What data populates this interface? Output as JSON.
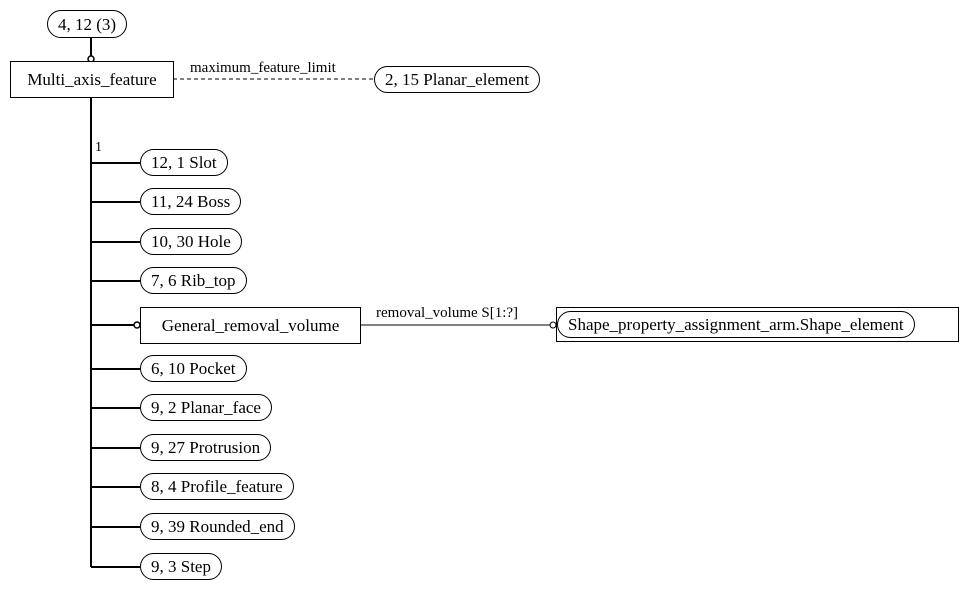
{
  "diagram": {
    "parent_ref": "4, 12 (3)",
    "main_entity": "Multi_axis_feature",
    "dashed_relation": {
      "label": "maximum_feature_limit",
      "target": "2, 15 Planar_element"
    },
    "cardinality": "1",
    "subtypes": [
      {
        "label": "12, 1 Slot"
      },
      {
        "label": "11, 24 Boss"
      },
      {
        "label": "10, 30 Hole"
      },
      {
        "label": "7, 6 Rib_top"
      },
      {
        "label": "General_removal_volume",
        "kind": "entity"
      },
      {
        "label": "6, 10 Pocket"
      },
      {
        "label": "9, 2 Planar_face"
      },
      {
        "label": "9, 27 Protrusion"
      },
      {
        "label": "8, 4 Profile_feature"
      },
      {
        "label": "9, 39 Rounded_end"
      },
      {
        "label": "9, 3 Step"
      }
    ],
    "removal_relation": {
      "label": "removal_volume S[1:?]",
      "target": "Shape_property_assignment_arm.Shape_element"
    }
  }
}
